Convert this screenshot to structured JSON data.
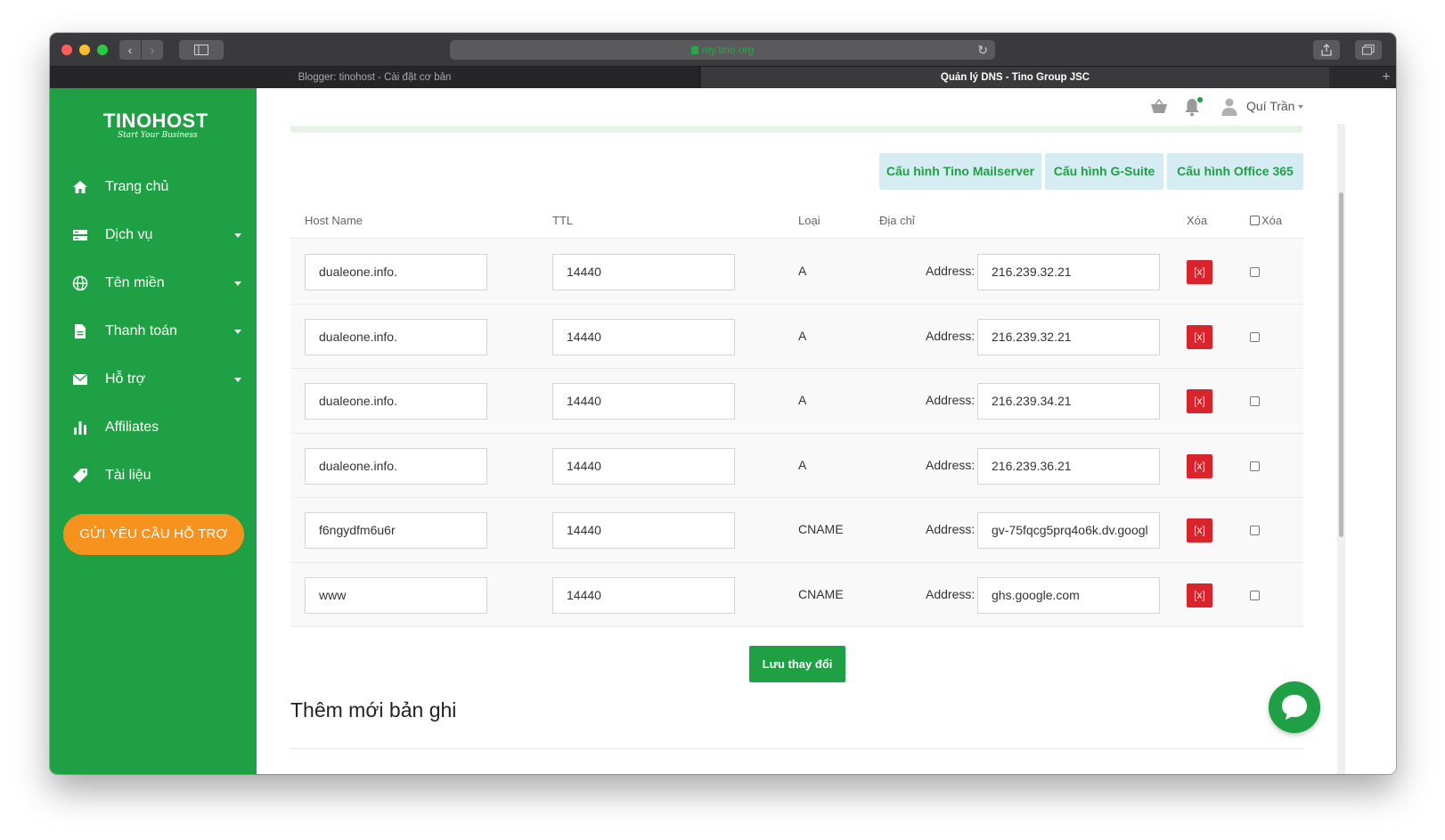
{
  "browser": {
    "url": "my.tino.org",
    "tabs": [
      {
        "label": "Blogger: tinohost - Cài đặt cơ bản",
        "active": false
      },
      {
        "label": "Quản lý DNS - Tino Group JSC",
        "active": true
      }
    ],
    "new_tab_label": "+"
  },
  "brand": {
    "name": "TINOHOST",
    "tagline": "Start Your Business",
    "primary_color": "#1fa045",
    "accent_color": "#f7921e",
    "danger_color": "#d9232d"
  },
  "sidebar": {
    "items": [
      {
        "label": "Trang chủ",
        "icon": "home-icon",
        "has_caret": false
      },
      {
        "label": "Dịch vụ",
        "icon": "server-icon",
        "has_caret": true
      },
      {
        "label": "Tên miền",
        "icon": "globe-icon",
        "has_caret": true
      },
      {
        "label": "Thanh toán",
        "icon": "document-icon",
        "has_caret": true
      },
      {
        "label": "Hỗ trợ",
        "icon": "envelope-icon",
        "has_caret": true
      },
      {
        "label": "Affiliates",
        "icon": "bar-chart-icon",
        "has_caret": false
      },
      {
        "label": "Tài liệu",
        "icon": "tag-icon",
        "has_caret": false
      }
    ],
    "support_button": "GỬI YÊU CẦU HỖ TRỢ"
  },
  "header": {
    "user_name": "Quí Trần",
    "icons": [
      "basket-icon",
      "bell-icon",
      "user-icon"
    ]
  },
  "config_buttons": [
    "Cấu hình Tino Mailserver",
    "Cấu hình G-Suite",
    "Cấu hình Office 365"
  ],
  "table": {
    "headers": {
      "host": "Host Name",
      "ttl": "TTL",
      "type": "Loại",
      "address": "Địa chỉ",
      "delete": "Xóa",
      "delete_check": "Xóa"
    },
    "address_label": "Address:",
    "delete_button": "[x]",
    "rows": [
      {
        "host": "dualeone.info.",
        "ttl": "14440",
        "type": "A",
        "address": "216.239.32.21"
      },
      {
        "host": "dualeone.info.",
        "ttl": "14440",
        "type": "A",
        "address": "216.239.32.21"
      },
      {
        "host": "dualeone.info.",
        "ttl": "14440",
        "type": "A",
        "address": "216.239.34.21"
      },
      {
        "host": "dualeone.info.",
        "ttl": "14440",
        "type": "A",
        "address": "216.239.36.21"
      },
      {
        "host": "f6ngydfm6u6r",
        "ttl": "14440",
        "type": "CNAME",
        "address": "gv-75fqcg5prq4o6k.dv.googl"
      },
      {
        "host": "www",
        "ttl": "14440",
        "type": "CNAME",
        "address": "ghs.google.com"
      }
    ]
  },
  "save_button": "Lưu thay đổi",
  "section_title": "Thêm mới bản ghi"
}
